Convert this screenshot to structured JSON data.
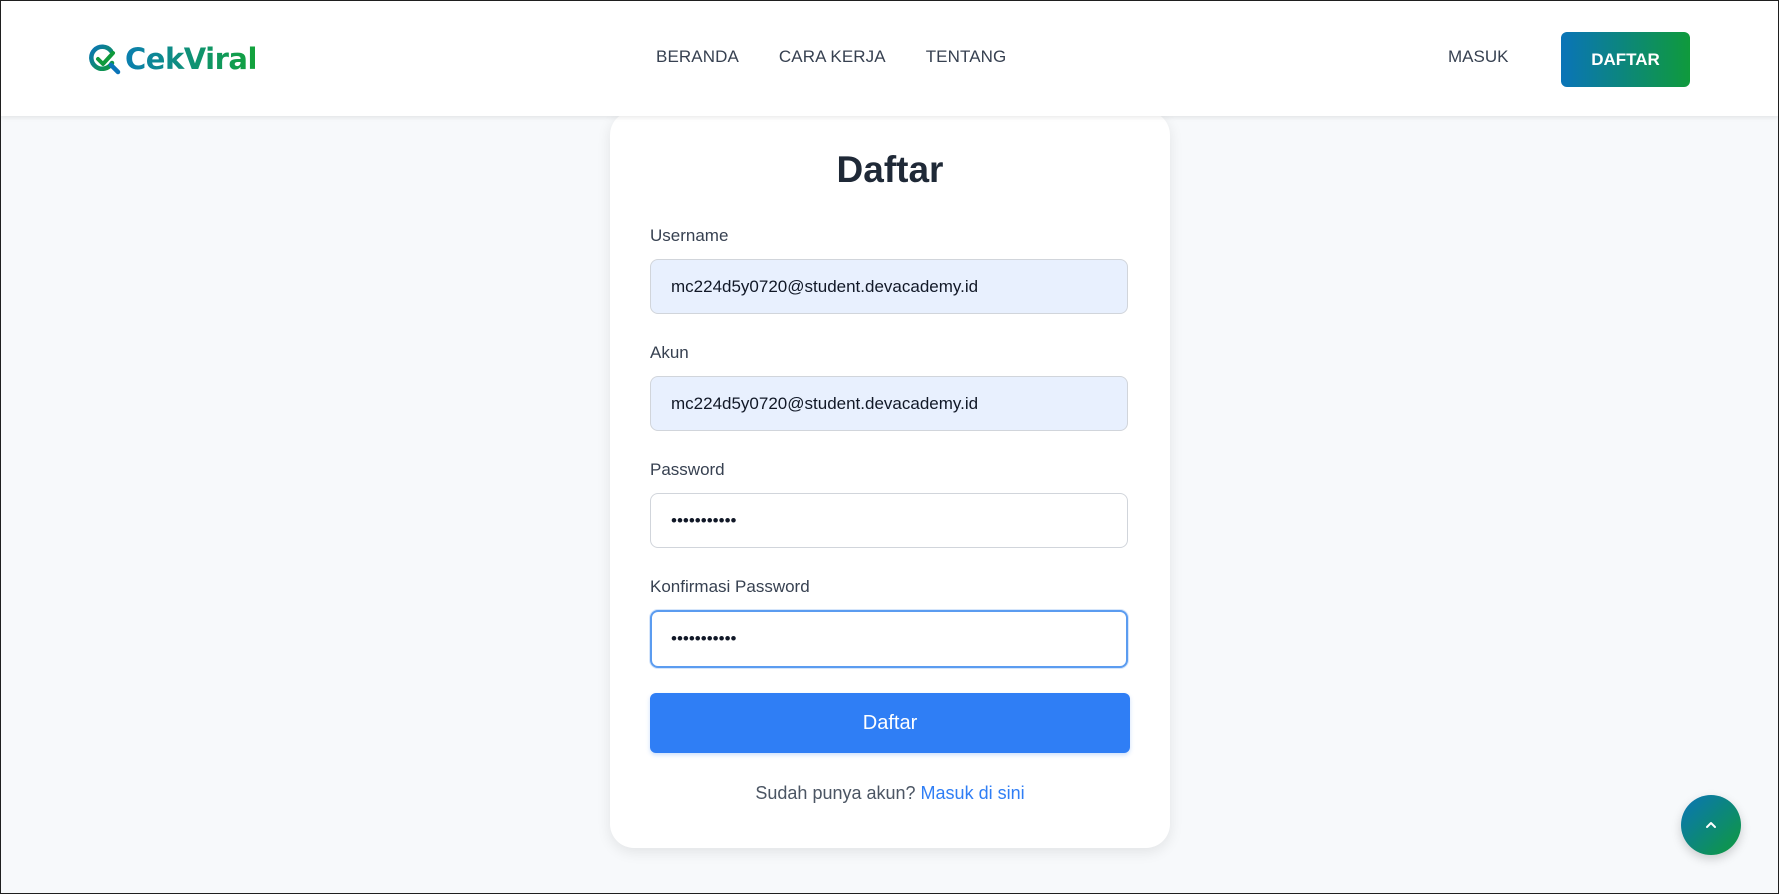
{
  "brand": {
    "name": "CekViral",
    "colors": {
      "gradient_start": "#0a74b8",
      "gradient_end": "#0f9a3c"
    }
  },
  "header": {
    "nav": [
      {
        "label": "BERANDA"
      },
      {
        "label": "CARA KERJA"
      },
      {
        "label": "TENTANG"
      }
    ],
    "login_label": "MASUK",
    "register_label": "DAFTAR"
  },
  "form": {
    "title": "Daftar",
    "fields": [
      {
        "label": "Username",
        "value": "mc224d5y0720@student.devacademy.id",
        "type": "text",
        "state": "autofilled"
      },
      {
        "label": "Akun",
        "value": "mc224d5y0720@student.devacademy.id",
        "type": "text",
        "state": "autofilled"
      },
      {
        "label": "Password",
        "value": "•••••••••••",
        "type": "password",
        "state": "filled"
      },
      {
        "label": "Konfirmasi Password",
        "value": "•••••••••••",
        "type": "password",
        "state": "focused"
      }
    ],
    "submit_label": "Daftar",
    "login_prompt": "Sudah punya akun?",
    "login_link": "Masuk di sini",
    "accent_color": "#2f7ef5"
  },
  "scroll_top": {
    "icon": "chevron-up-icon"
  }
}
